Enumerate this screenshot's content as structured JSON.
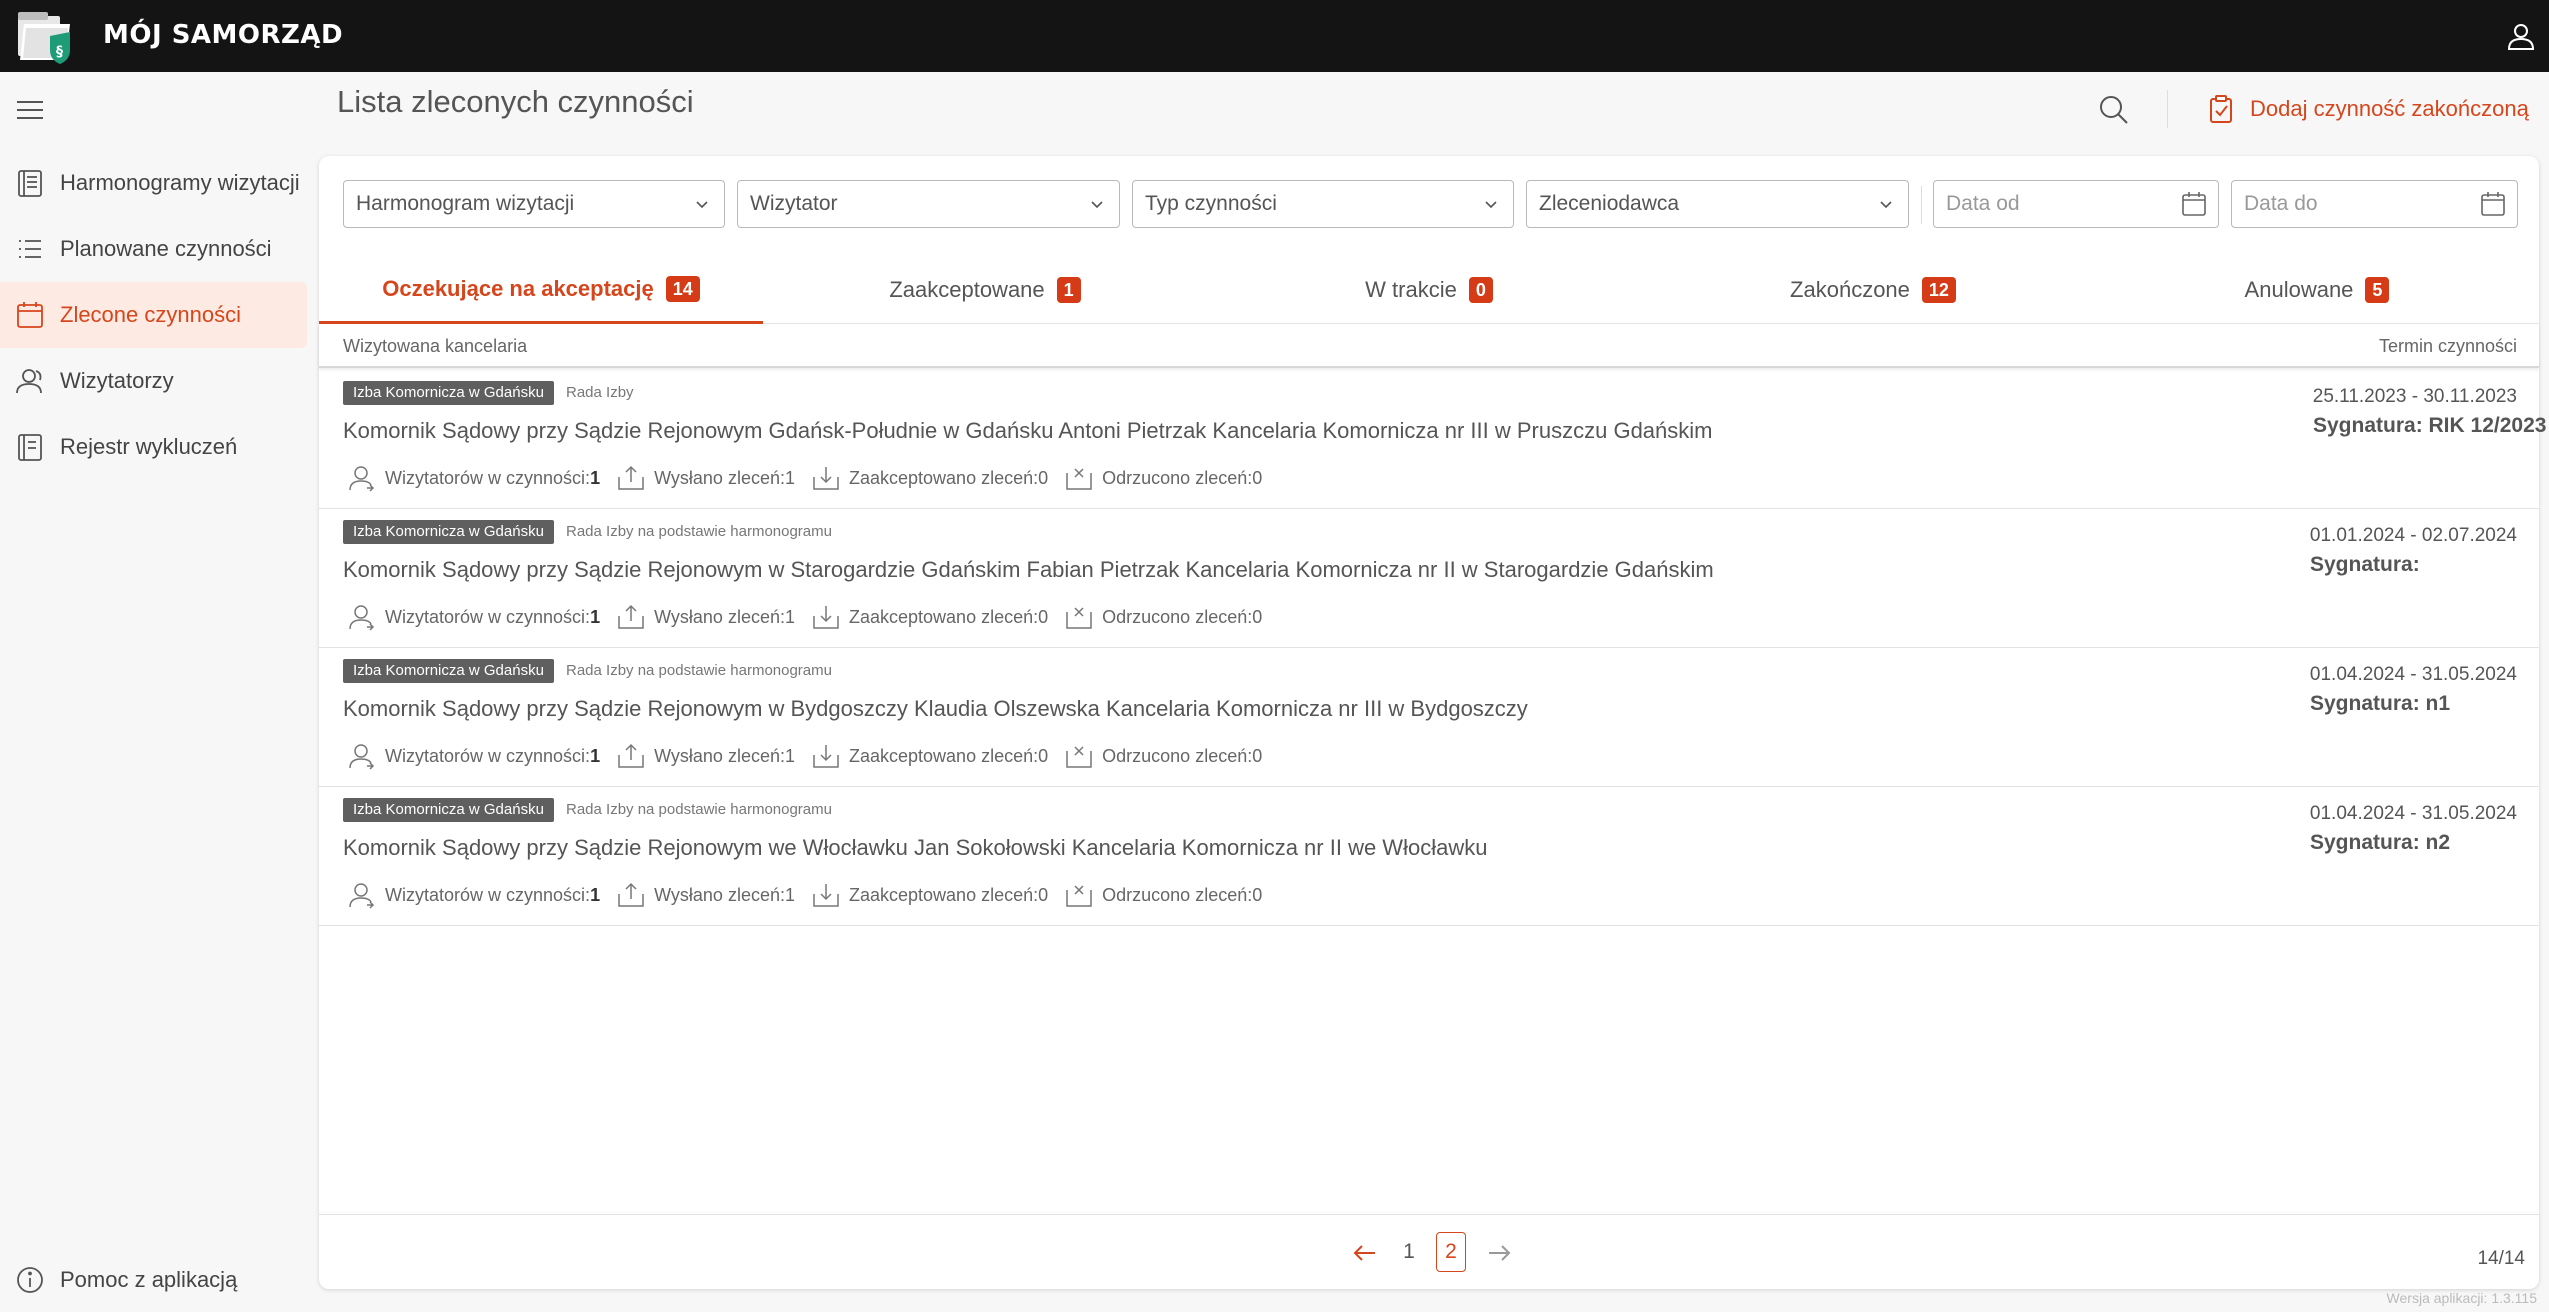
{
  "app": {
    "title": "MÓJ SAMORZĄD"
  },
  "sidebar": {
    "items": [
      {
        "label": "Harmonogramy wizytacji",
        "icon": "document-list-icon",
        "active": false
      },
      {
        "label": "Planowane czynności",
        "icon": "list-icon",
        "active": false
      },
      {
        "label": "Zlecone czynności",
        "icon": "calendar-icon",
        "active": true
      },
      {
        "label": "Wizytatorzy",
        "icon": "users-icon",
        "active": false
      },
      {
        "label": "Rejestr wykluczeń",
        "icon": "register-book-icon",
        "active": false
      }
    ],
    "help_label": "Pomoc z aplikacją"
  },
  "header": {
    "title": "Lista zleconych czynności",
    "add_done_label": "Dodaj czynność zakończoną"
  },
  "filters": {
    "schedule": "Harmonogram wizytacji",
    "inspector": "Wizytator",
    "activity_type": "Typ czynności",
    "client": "Zleceniodawca",
    "date_from_placeholder": "Data od",
    "date_to_placeholder": "Data do"
  },
  "tabs": [
    {
      "label": "Oczekujące na akceptację",
      "count": "14"
    },
    {
      "label": "Zaakceptowane",
      "count": "1"
    },
    {
      "label": "W trakcie",
      "count": "0"
    },
    {
      "label": "Zakończone",
      "count": "12"
    },
    {
      "label": "Anulowane",
      "count": "5"
    }
  ],
  "list_header": {
    "left": "Wizytowana kancelaria",
    "right": "Termin czynności"
  },
  "stat_labels": {
    "inspectors": "Wizytatorów w czynności:",
    "sent": "Wysłano zleceń: ",
    "accepted": "Zaakceptowano zleceń: ",
    "rejected": "Odrzucono zleceń: "
  },
  "rows": [
    {
      "tag": "Izba Komornicza w Gdańsku",
      "source": "Rada Izby",
      "office": "Komornik Sądowy przy Sądzie Rejonowym Gdańsk-Południe w Gdańsku Antoni Pietrzak Kancelaria Komornicza nr III w Pruszczu Gdańskim",
      "inspectors": "1",
      "sent": "1",
      "accepted": "0",
      "rejected": "0",
      "dates": "25.11.2023 - 30.11.2023",
      "signature": "Sygnatura: RIK 12/2023"
    },
    {
      "tag": "Izba Komornicza w Gdańsku",
      "source": "Rada Izby na podstawie harmonogramu",
      "office": "Komornik Sądowy przy Sądzie Rejonowym w Starogardzie Gdańskim Fabian Pietrzak Kancelaria Komornicza nr II w Starogardzie Gdańskim",
      "inspectors": "1",
      "sent": "1",
      "accepted": "0",
      "rejected": "0",
      "dates": "01.01.2024 - 02.07.2024",
      "signature": "Sygnatura:"
    },
    {
      "tag": "Izba Komornicza w Gdańsku",
      "source": "Rada Izby na podstawie harmonogramu",
      "office": "Komornik Sądowy przy Sądzie Rejonowym w Bydgoszczy Klaudia Olszewska Kancelaria Komornicza nr III w Bydgoszczy",
      "inspectors": "1",
      "sent": "1",
      "accepted": "0",
      "rejected": "0",
      "dates": "01.04.2024 - 31.05.2024",
      "signature": "Sygnatura: n1"
    },
    {
      "tag": "Izba Komornicza w Gdańsku",
      "source": "Rada Izby na podstawie harmonogramu",
      "office": "Komornik Sądowy przy Sądzie Rejonowym we Włocławku Jan Sokołowski Kancelaria Komornicza nr II we Włocławku",
      "inspectors": "1",
      "sent": "1",
      "accepted": "0",
      "rejected": "0",
      "dates": "01.04.2024 - 31.05.2024",
      "signature": "Sygnatura: n2"
    }
  ],
  "pagination": {
    "pages": [
      "1",
      "2"
    ],
    "current": "2",
    "count": "14/14"
  },
  "version": "Wersja aplikacji: 1.3.115",
  "colors": {
    "accent": "#d6461c",
    "badge": "#d43b16",
    "topbar": "#141414",
    "active_bg": "#fdebe3"
  }
}
